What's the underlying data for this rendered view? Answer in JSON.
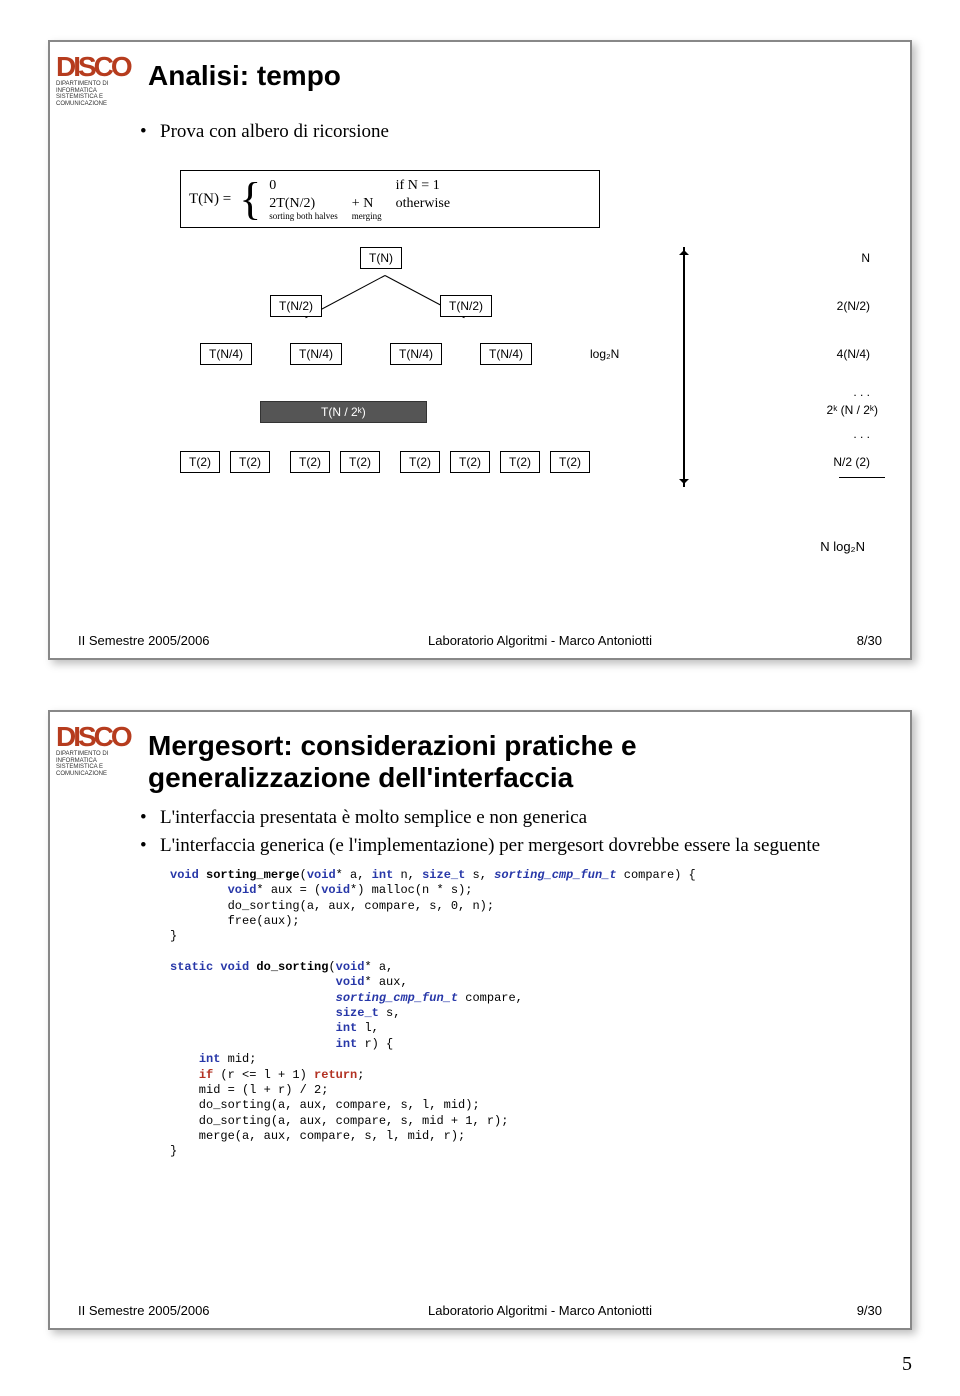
{
  "page_number": "5",
  "logo": {
    "name": "DISCO",
    "sub": "DIPARTIMENTO DI INFORMATICA SISTEMISTICA E COMUNICAZIONE"
  },
  "slide1": {
    "title": "Analisi: tempo",
    "bullets": [
      "Prova con albero di ricorsione"
    ],
    "formula": {
      "lhs": "T(N) =",
      "row1_a": "0",
      "row1_b": "",
      "row1_c": "if N = 1",
      "row2_a": "2T(N/2)",
      "row2_b": "+    N",
      "row2_c": "otherwise",
      "note_a": "sorting both halves",
      "note_b": "merging"
    },
    "tree": {
      "root": "T(N)",
      "r1_a": "T(N/2)",
      "r1_b": "T(N/2)",
      "r2": "T(N/4)",
      "bar": "T(N / 2ᵏ)",
      "leaf": "T(2)",
      "a_root": "N",
      "a_r1": "2(N/2)",
      "a_r2": "4(N/4)",
      "a_dots1": ". . .",
      "a_bar": "2ᵏ (N / 2ᵏ)",
      "a_dots2": ". . .",
      "a_leaf": "N/2 (2)",
      "height": "log₂N",
      "total": "N log₂N"
    },
    "footer": {
      "left": "II Semestre 2005/2006",
      "center": "Laboratorio Algoritmi - Marco Antoniotti",
      "right": "8/30"
    }
  },
  "slide2": {
    "title": "Mergesort: considerazioni pratiche e generalizzazione dell'interfaccia",
    "bullets": [
      "L'interfaccia presentata è molto semplice e non generica",
      "L'interfaccia generica (e l'implementazione) per mergesort dovrebbe essere la seguente"
    ],
    "code": {
      "c1": "void",
      "c2": "sorting_merge",
      "c3": "(",
      "c4": "void",
      "c5": "* a, ",
      "c6": "int",
      "c7": " n, ",
      "c8": "size_t",
      "c9": " s, ",
      "c10": "sorting_cmp_fun_t",
      "c11": " compare) {",
      "l2a": "        ",
      "l2b": "void",
      "l2c": "* aux = (",
      "l2d": "void",
      "l2e": "*) malloc(n * s);",
      "l3": "        do_sorting(a, aux, compare, s, 0, n);",
      "l4": "        free(aux);",
      "l5": "}",
      "l6a": "static void",
      "l6b": " ",
      "l6c": "do_sorting",
      "l6d": "(",
      "l6e": "void",
      "l6f": "* a,",
      "l7a": "                       ",
      "l7b": "void",
      "l7c": "* aux,",
      "l8a": "                       ",
      "l8b": "sorting_cmp_fun_t",
      "l8c": " compare,",
      "l9a": "                       ",
      "l9b": "size_t",
      "l9c": " s,",
      "l10a": "                       ",
      "l10b": "int",
      "l10c": " l,",
      "l11a": "                       ",
      "l11b": "int",
      "l11c": " r) {",
      "l12a": "    ",
      "l12b": "int",
      "l12c": " mid;",
      "l13a": "    ",
      "l13b": "if",
      "l13c": " (r <= l + 1) ",
      "l13d": "return",
      "l13e": ";",
      "l14": "    mid = (l + r) / 2;",
      "l15": "    do_sorting(a, aux, compare, s, l, mid);",
      "l16": "    do_sorting(a, aux, compare, s, mid + 1, r);",
      "l17": "    merge(a, aux, compare, s, l, mid, r);",
      "l18": "}"
    },
    "footer": {
      "left": "II Semestre 2005/2006",
      "center": "Laboratorio Algoritmi - Marco Antoniotti",
      "right": "9/30"
    }
  }
}
